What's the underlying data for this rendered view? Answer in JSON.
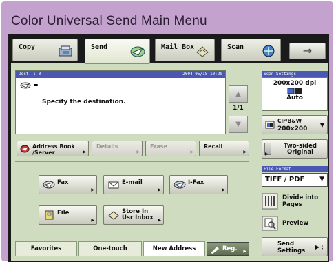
{
  "caption": "Color Universal Send Main Menu",
  "tabs": [
    {
      "label": "Copy",
      "icon": "copy-icon"
    },
    {
      "label": "Send",
      "icon": "send-icon"
    },
    {
      "label": "Mail Box",
      "icon": "mailbox-icon"
    },
    {
      "label": "Scan",
      "icon": "scan-icon"
    }
  ],
  "next_arrow": "→",
  "destination": {
    "header_left": "Dest. :   0",
    "header_right": "2004 05/18 10:20",
    "icon_text": "=",
    "message": "Specify the destination.",
    "page": "1/1"
  },
  "action_buttons": {
    "address_book": "Address Book\n/Server",
    "details": "Details",
    "erase": "Erase",
    "recall": "Recall"
  },
  "send_types": {
    "fax": "Fax",
    "email": "E-mail",
    "ifax": "I-Fax",
    "file": "File",
    "store": "Store In\nUsr Inbox"
  },
  "bottom_tabs": {
    "favorites": "Favorites",
    "one_touch": "One-touch",
    "new_address": "New Address",
    "reg": "Reg."
  },
  "scan_settings": {
    "header": "Scan Settings",
    "resolution": "200x200 dpi",
    "mode": "Auto",
    "select_top": "Clr/B&W",
    "select_bottom": "200x200"
  },
  "two_sided": "Two-sided\nOriginal",
  "file_format": {
    "header": "File Format",
    "value": "TIFF / PDF"
  },
  "divide": "Divide into\nPages",
  "preview": "Preview",
  "send_settings": "Send\nSettings",
  "colors": {
    "frame": "#c3a2cd",
    "panel": "#cfdcc0",
    "header_blue": "#4b58b3"
  }
}
